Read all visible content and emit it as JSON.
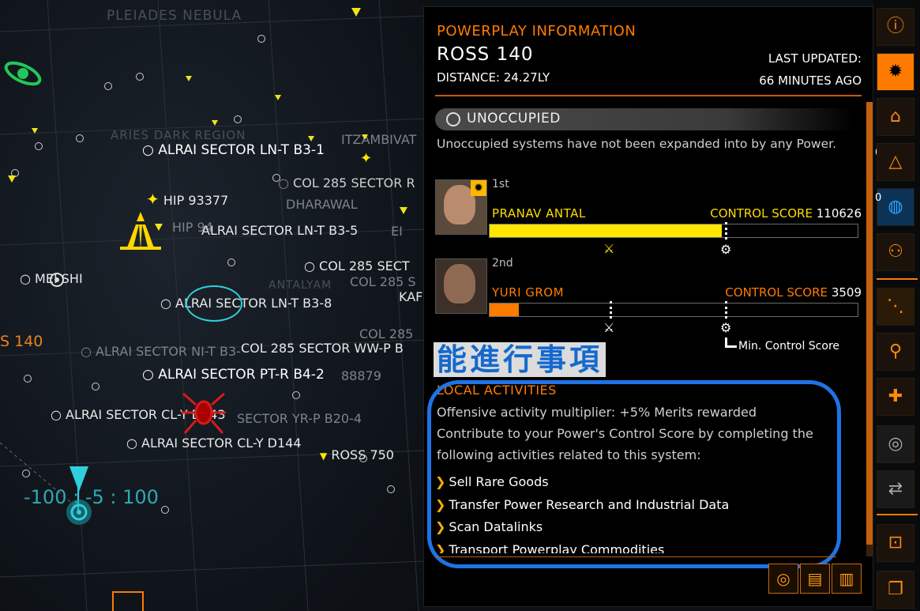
{
  "map": {
    "labels": {
      "pleiades": "PLEIADES NEBULA",
      "aries": "ARIES DARK REGION",
      "itzamb": "ITZAMBIVAT",
      "sol_lnt_b3_1": "ALRAI SECTOR LN-T B3-1",
      "hip_93377": "HIP 93377",
      "col_285_r": "COL 285 SECTOR R",
      "dharawal": "DHARAWAL",
      "hip_94": "HIP 94",
      "lnt_b3_5": "ALRAI SECTOR LN-T B3-5",
      "el": "EI",
      "col_285_sect": "COL 285 SECT",
      "col_285_s2": "COL 285 S",
      "antalyam": "ANTALYAM",
      "ka": "KAF",
      "mei_shi": "MEI SHI",
      "lnt_b3_8": "ALRAI SECTOR LN-T B3-8",
      "col_285_3": "COL 285",
      "s140": "S 140",
      "ni_t": "ALRAI SECTOR NI-T B3-",
      "col_285_wwp": "COL 285 SECTOR WW-P B",
      "pt_r": "ALRAI SECTOR PT-R B4-2",
      "n88879": "88879",
      "cly_d143": "ALRAI SECTOR CL-Y D143",
      "yr_p": "SECTOR YR-P B20-4",
      "cly_d144": "ALRAI SECTOR CL-Y D144",
      "ross_750": "ROSS 750",
      "coords": "-100 : -5 : 100"
    }
  },
  "panel": {
    "title": "POWERPLAY INFORMATION",
    "system_name": "ROSS 140",
    "distance": "DISTANCE: 24.27LY",
    "last_updated_label": "LAST UPDATED:",
    "last_updated_value": "66 MINUTES AGO",
    "status": "UNOCCUPIED",
    "status_desc": "Unoccupied systems have not been expanded into by any Power.",
    "powers": [
      {
        "rank": "1st",
        "name": "PRANAV ANTAL",
        "score_label": "CONTROL SCORE",
        "score": "110626",
        "fill": 0.63,
        "color": "#ffe600"
      },
      {
        "rank": "2nd",
        "name": "YURI GROM",
        "score_label": "CONTROL SCORE",
        "score": "3509",
        "fill": 0.08,
        "color": "#ff7a00"
      }
    ],
    "min_score_label": "Min. Control Score",
    "overlay_caption": "能進行事項",
    "local_activities_title": "LOCAL ACTIVITIES",
    "multiplier_text": "Offensive activity multiplier: +5% Merits rewarded",
    "contribute_text": "Contribute to your Power's Control Score by completing the following activities related to this system:",
    "activities": [
      "Sell Rare Goods",
      "Transfer Power Research and Industrial Data",
      "Scan Datalinks",
      "Transport Powerplay Commodities"
    ],
    "bottom_buttons": [
      "globe-icon",
      "book-icon",
      "book-stack-icon"
    ]
  },
  "toolbar": {
    "badges": {
      "rings": "0",
      "globe": "0"
    },
    "buttons": [
      "info-icon",
      "powerplay-icon",
      "route-icon",
      "rings-icon",
      "globe-icon",
      "users-icon",
      "route-nodes-icon",
      "map-pin-icon",
      "bookmark-icon",
      "target-icon",
      "swap-icon",
      "focus-icon",
      "copy-icon"
    ]
  },
  "colors": {
    "accent": "#ff7a00",
    "yellow": "#ffe600",
    "blue_highlight": "#1e73e6",
    "teal": "#2fd0dc"
  }
}
